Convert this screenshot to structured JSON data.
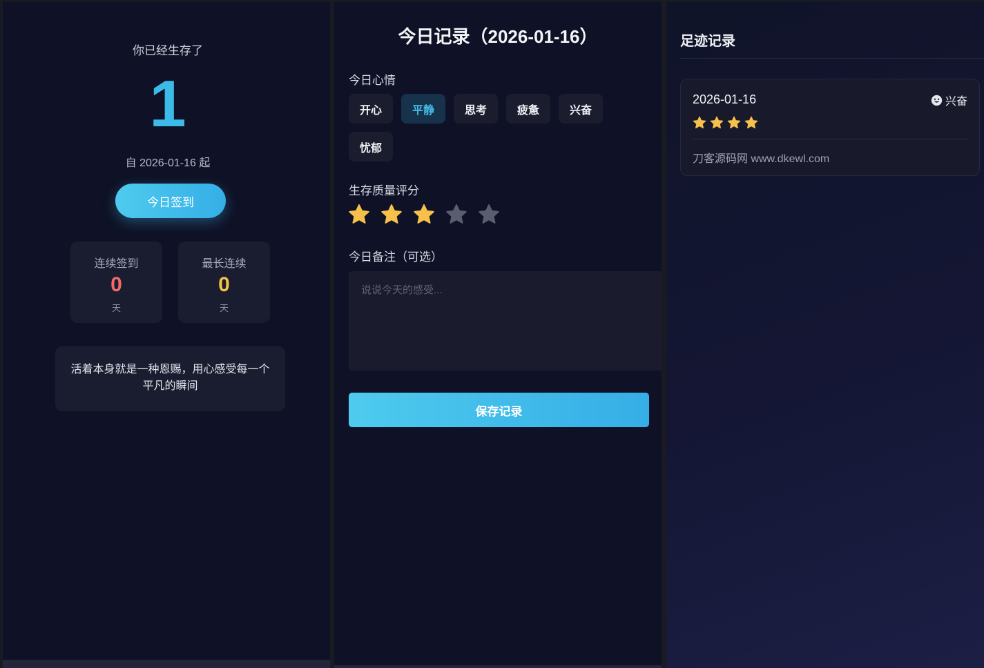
{
  "left": {
    "survive_label": "你已经生存了",
    "days": "1",
    "since": "自 2026-01-16 起",
    "checkin_button": "今日签到",
    "stats": [
      {
        "label": "连续签到",
        "value": "0",
        "unit": "天",
        "color": "#f26b6b"
      },
      {
        "label": "最长连续",
        "value": "0",
        "unit": "天",
        "color": "#f4c542"
      }
    ],
    "quote": "活着本身就是一种恩赐，用心感受每一个平凡的瞬间"
  },
  "middle": {
    "title": "今日记录（2026-01-16）",
    "mood_label": "今日心情",
    "moods": [
      {
        "label": "开心",
        "selected": false
      },
      {
        "label": "平静",
        "selected": true
      },
      {
        "label": "思考",
        "selected": false
      },
      {
        "label": "疲惫",
        "selected": false
      },
      {
        "label": "兴奋",
        "selected": false
      },
      {
        "label": "忧郁",
        "selected": false
      }
    ],
    "rating_label": "生存质量评分",
    "rating": 3,
    "rating_max": 5,
    "note_label": "今日备注（可选）",
    "note_placeholder": "说说今天的感受...",
    "save_button": "保存记录"
  },
  "right": {
    "title": "足迹记录",
    "records": [
      {
        "date": "2026-01-16",
        "mood": "兴奋",
        "mood_icon": "smiley-face-icon",
        "stars": 4,
        "note": "刀客源码网 www.dkewl.com"
      }
    ]
  },
  "colors": {
    "accent": "#3dbbe8",
    "star_filled": "#f7c04a",
    "star_empty": "#5a5d70",
    "panel_bg": "#0f1226"
  }
}
